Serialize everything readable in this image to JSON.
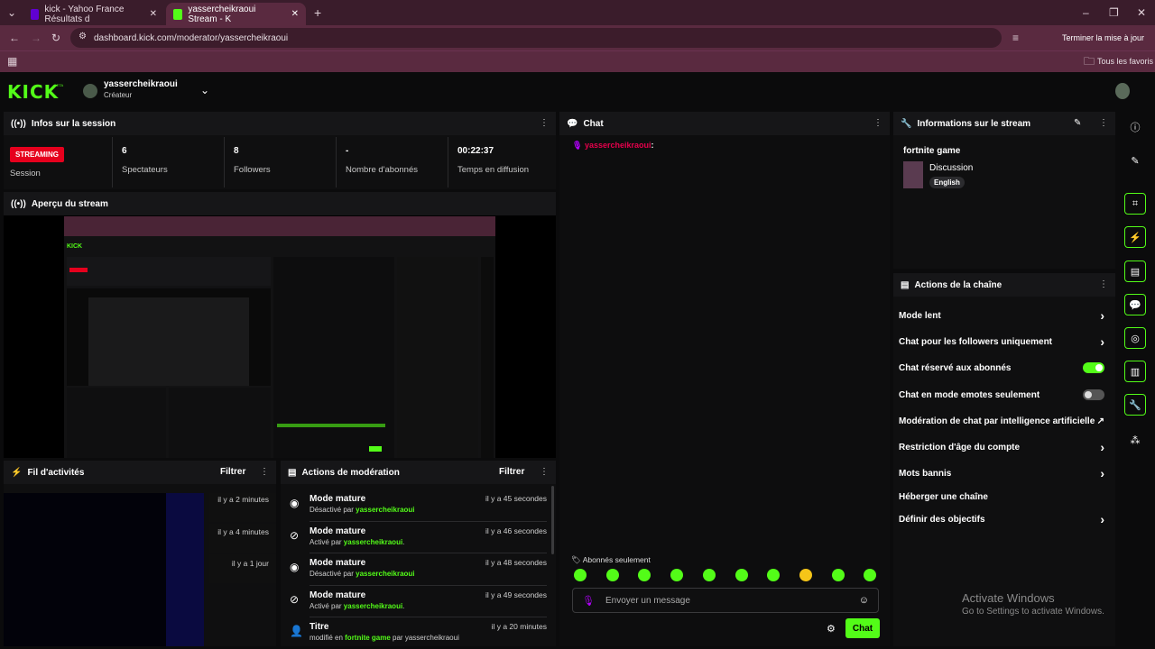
{
  "browser": {
    "tabs": [
      {
        "label": "kick - Yahoo France Résultats d"
      },
      {
        "label": "yassercheikraoui Stream - K"
      }
    ],
    "new_tab": "+",
    "url": "dashboard.kick.com/moderator/yassercheikraoui",
    "update_button": "Terminer la mise à jour",
    "bookmarks_label": "Tous les favoris"
  },
  "header": {
    "logo": "KICK",
    "beta": "BETA",
    "username": "yassercheikraoui",
    "role": "Créateur"
  },
  "session": {
    "title": "Infos sur la session",
    "badge": "STREAMING",
    "status_label": "Session",
    "stats": [
      {
        "value": "6",
        "label": "Spectateurs"
      },
      {
        "value": "8",
        "label": "Followers"
      },
      {
        "value": "-",
        "label": "Nombre d'abonnés"
      },
      {
        "value": "00:22:37",
        "label": "Temps en diffusion"
      }
    ]
  },
  "preview": {
    "title": "Aperçu du stream"
  },
  "activity": {
    "title": "Fil d'activités",
    "filter": "Filtrer",
    "items": [
      {
        "time": "il y a 2 minutes"
      },
      {
        "time": "il y a 4 minutes"
      },
      {
        "time": "il y a 1 jour"
      }
    ]
  },
  "moderation": {
    "title": "Actions de modération",
    "filter": "Filtrer",
    "rows": [
      {
        "title": "Mode mature",
        "action": "Désactivé par ",
        "user": "yassercheikraoui",
        "suffix": "",
        "time": "il y a 45 secondes",
        "icon": "eye-icon"
      },
      {
        "title": "Mode mature",
        "action": "Activé par ",
        "user": "yassercheikraoui",
        "suffix": ".",
        "time": "il y a 46 secondes",
        "icon": "eye-off-icon"
      },
      {
        "title": "Mode mature",
        "action": "Désactivé par ",
        "user": "yassercheikraoui",
        "suffix": "",
        "time": "il y a 48 secondes",
        "icon": "eye-icon"
      },
      {
        "title": "Mode mature",
        "action": "Activé par ",
        "user": "yassercheikraoui",
        "suffix": ".",
        "time": "il y a 49 secondes",
        "icon": "eye-off-icon"
      },
      {
        "title": "Titre",
        "action": "modifié en ",
        "user": "fortnite game",
        "suffix": " par yassercheikraoui",
        "time": "il y a 20 minutes",
        "icon": "user-edit-icon"
      }
    ]
  },
  "chat": {
    "title": "Chat",
    "message_user": "yassercheikraoui",
    "message_sep": ":",
    "subscribers_only": "Abonnés seulement",
    "placeholder": "Envoyer un message",
    "send": "Chat"
  },
  "stream_info": {
    "title": "Informations sur le stream",
    "stream_title": "fortnite game",
    "category": "Discussion",
    "language": "English"
  },
  "channel_actions": {
    "title": "Actions de la chaîne",
    "items": [
      {
        "label": "Mode lent",
        "control": "chevron"
      },
      {
        "label": "Chat pour les followers uniquement",
        "control": "chevron"
      },
      {
        "label": "Chat réservé aux abonnés",
        "control": "toggle-on"
      },
      {
        "label": "Chat en mode emotes seulement",
        "control": "toggle-off"
      },
      {
        "label": "Modération de chat par intelligence artificielle",
        "control": "external"
      },
      {
        "label": "Restriction d'âge du compte",
        "control": "chevron"
      },
      {
        "label": "Mots bannis",
        "control": "chevron"
      },
      {
        "label": "Héberger une chaîne",
        "control": "none"
      },
      {
        "label": "Définir des objectifs",
        "control": "chevron"
      }
    ]
  },
  "windows": {
    "activate_title": "Activate Windows",
    "activate_sub": "Go to Settings to activate Windows."
  },
  "colors": {
    "accent": "#53fc18",
    "live": "#e6001d",
    "chrome": "#5a2a40"
  }
}
